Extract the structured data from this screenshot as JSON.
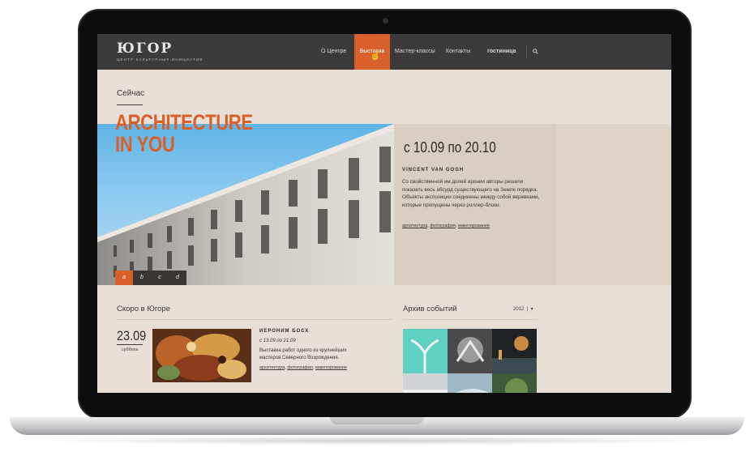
{
  "header": {
    "logo": "ЮГОР",
    "tagline": "ЦЕНТР КУЛЬТУРНЫХ ИНИЦИАТИВ",
    "nav": [
      {
        "label": "О Центре"
      },
      {
        "label": "Выставки",
        "active": true
      },
      {
        "label": "Мастер-классы"
      },
      {
        "label": "Контакты"
      },
      {
        "label": "гостиница"
      }
    ],
    "search_icon": "search-icon"
  },
  "now": {
    "heading": "Сейчас",
    "title_line1": "ARCHITECTURE",
    "title_line2": "IN YOU",
    "dates": "с 10.09 по 20.10",
    "artist": "VINCENT VAN GOGH",
    "description": "Со свойственной им долей иронии авторы решили показать весь абсурд существующего на Земле порядка. Объекты экспозиции соединены между собой веревками, которые пропущены через роллер-блоки.",
    "tags": [
      "архитектура",
      "фотография",
      "макетирование"
    ],
    "slides": [
      "a",
      "b",
      "c",
      "d"
    ],
    "active_slide": "a"
  },
  "soon": {
    "heading": "Скоро в Югоре",
    "date": "23.09",
    "day": "суббота",
    "artist": "ИЕРОНИМ БОСХ",
    "dates": "с 13.09 по 21.09",
    "description": "Выставка работ одного из крупнейших мастеров Северного Возрождения.",
    "tags": [
      "архитектура",
      "фотография",
      "макетирование"
    ]
  },
  "archive": {
    "heading": "Архив событий",
    "year": "2012"
  },
  "colors": {
    "accent": "#d95f2b",
    "header_bg": "#3b3b3c",
    "page_bg": "#e8e0d6"
  }
}
